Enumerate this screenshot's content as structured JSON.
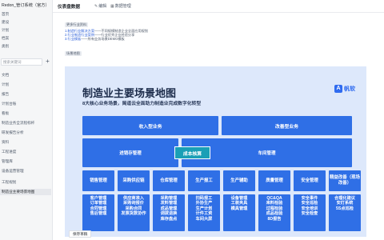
{
  "sidebar": {
    "title": "Redon_管订系统（官方）",
    "items_top": [
      "首页",
      "建设",
      "计划",
      "档案",
      "类别"
    ],
    "search_placeholder": "搜索关键词",
    "plus": "+",
    "items": [
      "文档",
      "计划",
      "报告",
      "计划台账",
      "看板",
      "制造业务全流程标杆",
      "研发报告分析",
      "资料",
      "工程进度",
      "管理库",
      "设备运营管理",
      "工程规划",
      "制造业主要场景地图"
    ]
  },
  "topbar": {
    "title": "仪表盘数据",
    "edit_label": "编辑",
    "share_label": "数据管理"
  },
  "doc": {
    "section1_tag": "更多行业资料",
    "links": [
      {
        "num": "1.",
        "link": "制造行业解决方案",
        "rest": "——不同规模制造企业全面应用规划"
      },
      {
        "num": "2.",
        "link": "行业制造行业案例",
        "rest": "——行业优秀企业经验分享"
      },
      {
        "num": "3.",
        "link": "行业模板",
        "rest": "——所有业务场景DEMO模板"
      }
    ],
    "section2_tag": "场景地图"
  },
  "banner": {
    "title": "制造业主要场景地图",
    "subtitle": "8大核心业务场景，简道云全面助力制造业完成数字化转型",
    "logo_text": "帆软",
    "logo_mark": "A"
  },
  "map": {
    "row1": [
      "收入型业务",
      "改善型业务"
    ],
    "row2": [
      "进销存管理",
      "车间管理"
    ],
    "core": "成本核算",
    "caps": [
      "销售管理",
      "采购供应链",
      "仓库管理",
      "生产报工",
      "生产辅助",
      "质量管理",
      "安全管理",
      "精益改善（现场改善）"
    ],
    "details": [
      "客户管理\n订单管理\n合同管理\n售后管理",
      "供应商准入\n采购询报价\n采购合同\n发票货款协作",
      "采购管理\n发料管理\n成品管理\n调拨退换\n库存盘点",
      "扫码报工\n外协生产\n生产计划\n计件工资\n车间大屏",
      "设备管理\n工装夹具\n模具管理",
      "QC&QA\n来料检验\n过程检验\n成品检验\n8D报告",
      "安全事件\n安全巡检\n安全培训\n安全检查",
      "合理化建议\n安灯系统\n5S点巡检"
    ]
  },
  "footer": {
    "save_label": "保存草稿"
  }
}
